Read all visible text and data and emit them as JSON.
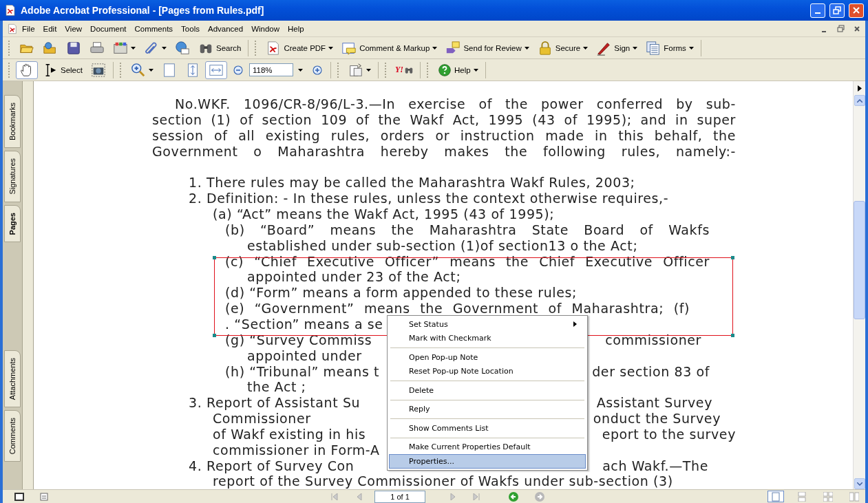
{
  "window": {
    "title": "Adobe Acrobat Professional - [Pages from Rules.pdf]"
  },
  "menu_bar": [
    "File",
    "Edit",
    "View",
    "Document",
    "Comments",
    "Tools",
    "Advanced",
    "Window",
    "Help"
  ],
  "toolbar_1": {
    "search": "Search",
    "labeled": [
      {
        "label": "Create PDF",
        "dropdown": true
      },
      {
        "label": "Comment & Markup",
        "dropdown": true
      },
      {
        "label": "Send for Review",
        "dropdown": true
      },
      {
        "label": "Secure",
        "dropdown": true
      },
      {
        "label": "Sign",
        "dropdown": true
      },
      {
        "label": "Forms",
        "dropdown": true
      }
    ]
  },
  "toolbar_2": {
    "select": "Select",
    "zoom": "118%",
    "search_logo": "Y!",
    "help": "Help"
  },
  "side_tabs": [
    {
      "label": "Bookmarks",
      "selected": false
    },
    {
      "label": "Signatures",
      "selected": false
    },
    {
      "label": "Pages",
      "selected": true
    },
    {
      "label": "Attachments",
      "selected": false
    },
    {
      "label": "Comments",
      "selected": false
    }
  ],
  "document": {
    "intro_lines": [
      {
        "kind": "first",
        "justify": true,
        "parts": [
          "No.WKF. 1096/CR-8/96/L-3.—In exercise of the power conferred by sub-"
        ]
      },
      {
        "kind": "para",
        "justify": true,
        "parts": [
          "section (1) of section 109 of the Wakf Act, 1995 (43 of 1995); and in super"
        ]
      },
      {
        "kind": "para",
        "justify": true,
        "parts": [
          "session of all existing rules, orders or instruction made in this behalf, the"
        ]
      },
      {
        "kind": "para",
        "justify": true,
        "parts": [
          "Government o Maharashtra hereby makes the following rules, namely:-"
        ]
      }
    ],
    "body_lines": [
      {
        "kind": "item",
        "justify": false,
        "parts": [
          "1.  There rules may be called the Maharashtra Wakf Rules, 2003;"
        ]
      },
      {
        "kind": "num",
        "justify": false,
        "parts": [
          "2. Definition: - In these rules, unless the context otherwise requires,-"
        ]
      },
      {
        "kind": "sub",
        "justify": false,
        "parts": [
          "(a) “Act” means the Wakf Act, 1995 (43 of 1995);"
        ]
      },
      {
        "kind": "subsub",
        "justify": true,
        "parts": [
          "(b) “Board” means the Maharashtra State Board of Wakfs"
        ]
      },
      {
        "kind": "cont",
        "justify": false,
        "parts": [
          "established under sub-section (1)of section13 o the Act;"
        ]
      },
      {
        "kind": "subsub",
        "justify": true,
        "parts": [
          "(c) “Chief Executive Officer” means the Chief Executive Officer"
        ]
      },
      {
        "kind": "cont",
        "justify": false,
        "parts": [
          "appointed under 23 of the Act;"
        ]
      },
      {
        "kind": "subsub",
        "justify": false,
        "parts": [
          "(d) “Form” means a form appended to these rules;"
        ]
      },
      {
        "kind": "subsub_short",
        "justify": true,
        "parts": [
          "(e) “Government” means the Government of Maharashtra; (f)"
        ]
      },
      {
        "kind": "subsub",
        "justify": false,
        "parts": [
          ". “Section” means a se"
        ]
      },
      {
        "kind": "subsub_g",
        "justify": true,
        "parts": [
          "(g)  “Survey Commiss",
          "commissioner"
        ]
      },
      {
        "kind": "cont",
        "justify": false,
        "parts": [
          "appointed under"
        ]
      },
      {
        "kind": "subsub",
        "justify": true,
        "parts": [
          "(h) “Tribunal” means t",
          "der section 83 of"
        ]
      },
      {
        "kind": "cont",
        "justify": false,
        "parts": [
          "the Act ;"
        ]
      },
      {
        "kind": "item_wide",
        "justify": true,
        "parts": [
          "3.  Report of Assistant Su",
          "Assistant Survey"
        ]
      },
      {
        "kind": "sub_wide",
        "justify": true,
        "parts": [
          "Commissioner",
          "onduct the Survey"
        ]
      },
      {
        "kind": "sub_full",
        "justify": true,
        "parts": [
          "of Wakf existing in his",
          "eport to the survey"
        ]
      },
      {
        "kind": "sub",
        "justify": false,
        "parts": [
          "commissioner in Form-A"
        ]
      },
      {
        "kind": "item",
        "justify": true,
        "parts": [
          "4.  Report of Survey Con",
          "ach Wakf.—The"
        ]
      },
      {
        "kind": "sub",
        "justify": false,
        "parts": [
          "report of the Survey Commissioner of Wakfs under sub-section (3)"
        ]
      }
    ]
  },
  "context_menu": {
    "groups": [
      [
        {
          "label": "Set Status",
          "submenu": true,
          "selected": false
        },
        {
          "label": "Mark with Checkmark",
          "submenu": false,
          "selected": false
        }
      ],
      [
        {
          "label": "Open Pop-up Note",
          "submenu": false,
          "selected": false
        },
        {
          "label": "Reset Pop-up Note Location",
          "submenu": false,
          "selected": false
        }
      ],
      [
        {
          "label": "Delete",
          "submenu": false,
          "selected": false
        }
      ],
      [
        {
          "label": "Reply",
          "submenu": false,
          "selected": false
        }
      ],
      [
        {
          "label": "Show Comments List",
          "submenu": false,
          "selected": false
        }
      ],
      [
        {
          "label": "Make Current Properties Default",
          "submenu": false,
          "selected": false
        },
        {
          "label": "Properties...",
          "submenu": false,
          "selected": true
        }
      ]
    ]
  },
  "status_bar": {
    "page": "1 of 1"
  }
}
